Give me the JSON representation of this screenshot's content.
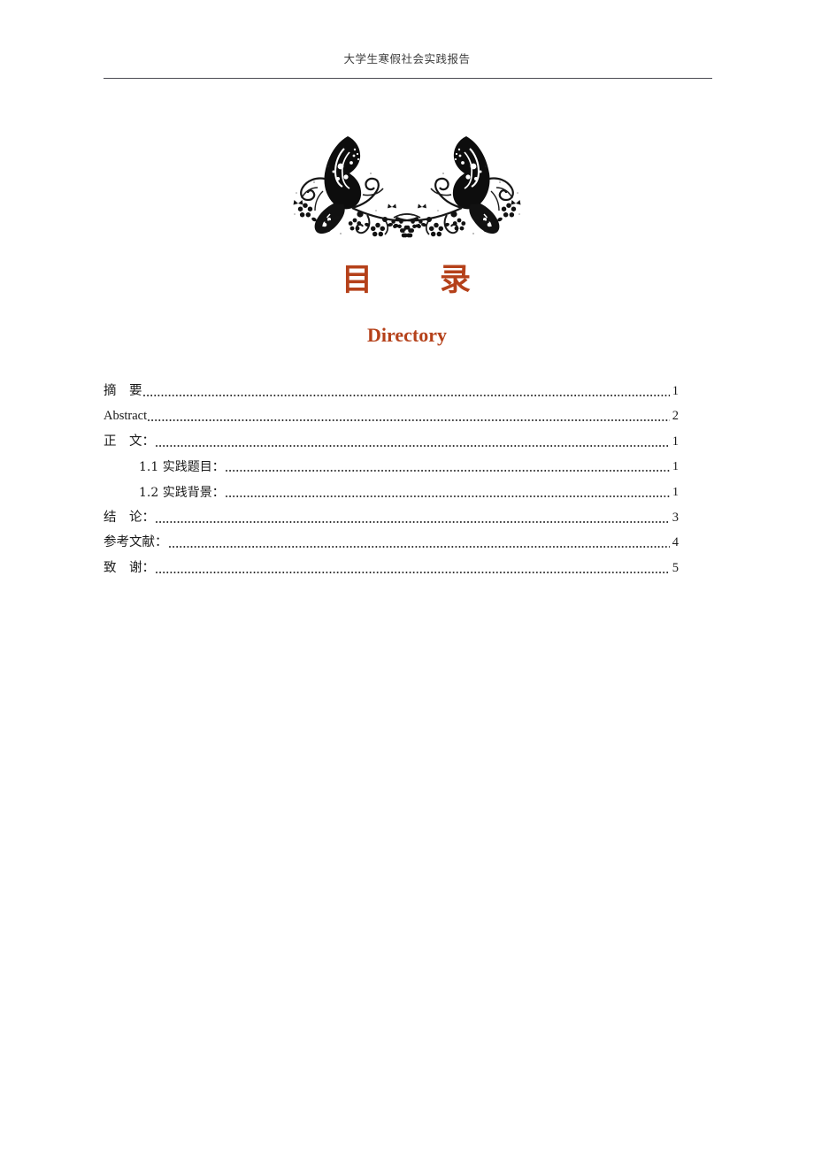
{
  "header": {
    "running_title": "大学生寒假社会实践报告"
  },
  "ornament": {
    "name": "butterfly-floral-ornament"
  },
  "title": {
    "main": "目　　录",
    "sub": "Directory",
    "color": "#b5411a"
  },
  "toc": {
    "entries": [
      {
        "label": "摘　要",
        "page": "1",
        "level": 1,
        "script": "cjk"
      },
      {
        "label": "Abstract",
        "page": "2",
        "level": 1,
        "script": "latin"
      },
      {
        "label": "正　文：",
        "page": "1",
        "level": 1,
        "script": "cjk"
      },
      {
        "label": "1.1 实践题目：",
        "page": "1",
        "level": 2,
        "script": "cjk"
      },
      {
        "label": "1.2 实践背景：",
        "page": "1",
        "level": 2,
        "script": "cjk"
      },
      {
        "label": "结　论：",
        "page": "3",
        "level": 1,
        "script": "cjk"
      },
      {
        "label": "参考文献：",
        "page": "4",
        "level": 1,
        "script": "cjk"
      },
      {
        "label": "致　谢：",
        "page": "5",
        "level": 1,
        "script": "cjk"
      }
    ]
  }
}
